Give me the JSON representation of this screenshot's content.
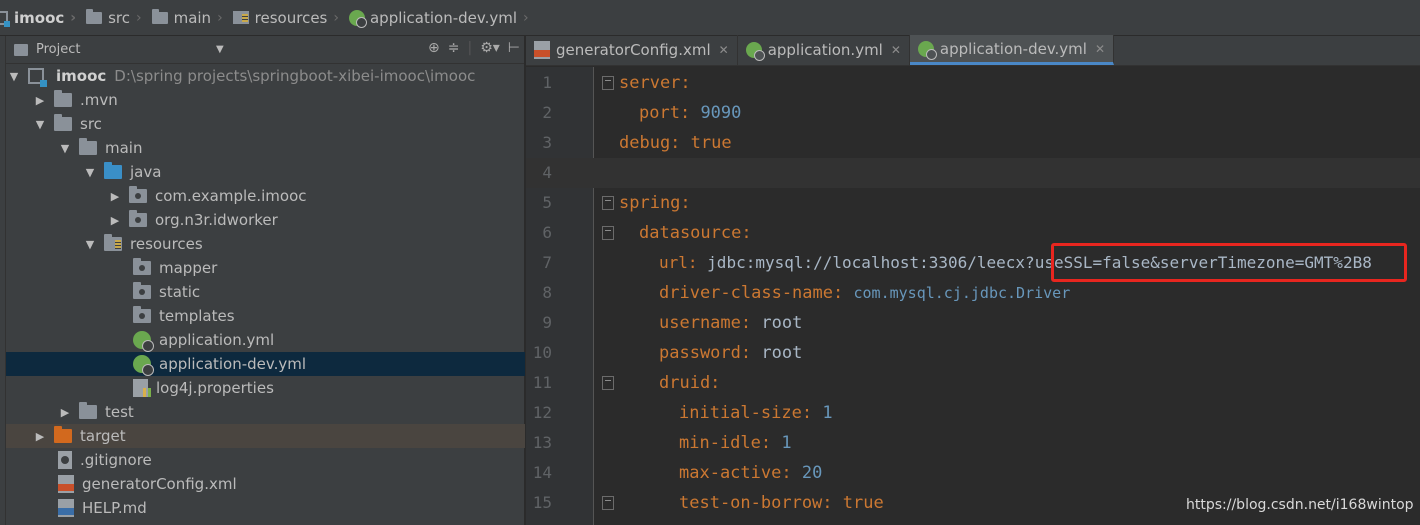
{
  "breadcrumb": [
    {
      "label": "imooc",
      "icon": "module-icon"
    },
    {
      "label": "src",
      "icon": "folder-icon"
    },
    {
      "label": "main",
      "icon": "folder-icon"
    },
    {
      "label": "resources",
      "icon": "resources-folder-icon"
    },
    {
      "label": "application-dev.yml",
      "icon": "spring-yml-icon"
    }
  ],
  "project_panel": {
    "title": "Project",
    "tree": [
      {
        "label": "imooc",
        "path": "D:\\spring projects\\springboot-xibei-imooc\\imooc",
        "arrow": "▼",
        "icon": "module-icon"
      },
      {
        "label": ".mvn",
        "arrow": "▶",
        "icon": "folder-icon"
      },
      {
        "label": "src",
        "arrow": "▼",
        "icon": "folder-icon"
      },
      {
        "label": "main",
        "arrow": "▼",
        "icon": "folder-icon"
      },
      {
        "label": "java",
        "arrow": "▼",
        "icon": "source-folder-icon"
      },
      {
        "label": "com.example.imooc",
        "arrow": "▶",
        "icon": "package-icon"
      },
      {
        "label": "org.n3r.idworker",
        "arrow": "▶",
        "icon": "package-icon"
      },
      {
        "label": "resources",
        "arrow": "▼",
        "icon": "resources-folder-icon"
      },
      {
        "label": "mapper",
        "arrow": "",
        "icon": "package-icon"
      },
      {
        "label": "static",
        "arrow": "",
        "icon": "package-icon"
      },
      {
        "label": "templates",
        "arrow": "",
        "icon": "package-icon"
      },
      {
        "label": "application.yml",
        "arrow": "",
        "icon": "spring-yml-icon"
      },
      {
        "label": "application-dev.yml",
        "arrow": "",
        "icon": "spring-yml-icon"
      },
      {
        "label": "log4j.properties",
        "arrow": "",
        "icon": "properties-file-icon"
      },
      {
        "label": "test",
        "arrow": "▶",
        "icon": "folder-icon"
      },
      {
        "label": "target",
        "arrow": "▶",
        "icon": "excluded-folder-icon"
      },
      {
        "label": ".gitignore",
        "arrow": "",
        "icon": "gitignore-file-icon"
      },
      {
        "label": "generatorConfig.xml",
        "arrow": "",
        "icon": "xml-file-icon"
      },
      {
        "label": "HELP.md",
        "arrow": "",
        "icon": "markdown-file-icon"
      }
    ]
  },
  "tabs": [
    {
      "label": "generatorConfig.xml",
      "icon": "xml-file-icon",
      "active": false
    },
    {
      "label": "application.yml",
      "icon": "spring-yml-icon",
      "active": false
    },
    {
      "label": "application-dev.yml",
      "icon": "spring-yml-icon",
      "active": true
    }
  ],
  "code_lines": [
    {
      "num": "1",
      "key": "server:",
      "value": "",
      "current": false
    },
    {
      "num": "2",
      "key": "port:",
      "value": "9090",
      "current": false
    },
    {
      "num": "3",
      "key": "debug:",
      "value": "true",
      "current": false
    },
    {
      "num": "4",
      "key": "",
      "value": "",
      "current": true
    },
    {
      "num": "5",
      "key": "spring:",
      "value": "",
      "current": false
    },
    {
      "num": "6",
      "key": "datasource:",
      "value": "",
      "current": false
    },
    {
      "num": "7",
      "key": "url:",
      "value": "jdbc:mysql://localhost:3306/leecx?useSSL=false&serverTimezone=GMT%2B8",
      "current": false
    },
    {
      "num": "8",
      "key": "driver-class-name:",
      "value": "com.mysql.cj.jdbc.Driver",
      "current": false
    },
    {
      "num": "9",
      "key": "username:",
      "value": "root",
      "current": false
    },
    {
      "num": "10",
      "key": "password:",
      "value": "root",
      "current": false
    },
    {
      "num": "11",
      "key": "druid:",
      "value": "",
      "current": false
    },
    {
      "num": "12",
      "key": "initial-size:",
      "value": "1",
      "current": false
    },
    {
      "num": "13",
      "key": "min-idle:",
      "value": "1",
      "current": false
    },
    {
      "num": "14",
      "key": "max-active:",
      "value": "20",
      "current": false
    },
    {
      "num": "15",
      "key": "test-on-borrow:",
      "value": "true",
      "current": false
    }
  ],
  "watermark": "https://blog.csdn.net/i168wintop",
  "colors": {
    "key": "#cc7832",
    "number": "#6897bb",
    "string": "#a9b7c6",
    "highlight_box": "#e8261f",
    "selected_row": "#0d293e"
  }
}
